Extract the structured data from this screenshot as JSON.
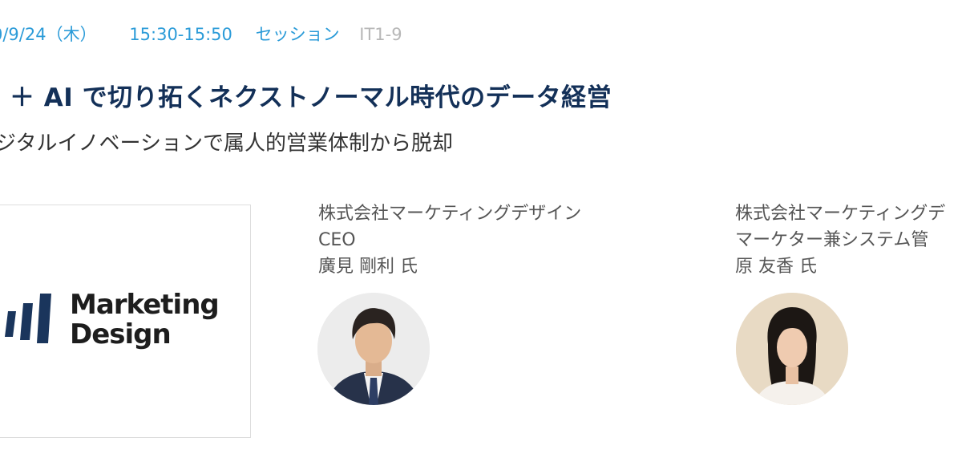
{
  "session": {
    "date": "0/9/24（木）",
    "time": "15:30-15:50",
    "type": "セッション",
    "code": "IT1-9"
  },
  "title": "＋ AI で切り拓くネクストノーマル時代のデータ経営",
  "subtitle": "ジタルイノベーションで属人的営業体制から脱却",
  "sponsor": {
    "logo_line1": "Marketing",
    "logo_line2": "Design",
    "logo_color": "#1a355c"
  },
  "speakers": [
    {
      "company": "株式会社マーケティングデザイン",
      "role": "CEO",
      "name": "廣見 剛利 氏"
    },
    {
      "company": "株式会社マーケティングデ",
      "role": "マーケター兼システム管",
      "name": "原 友香 氏"
    }
  ],
  "colors": {
    "accent": "#2b9bd8",
    "title": "#133058",
    "muted": "#b7b7b7",
    "text": "#555555"
  }
}
